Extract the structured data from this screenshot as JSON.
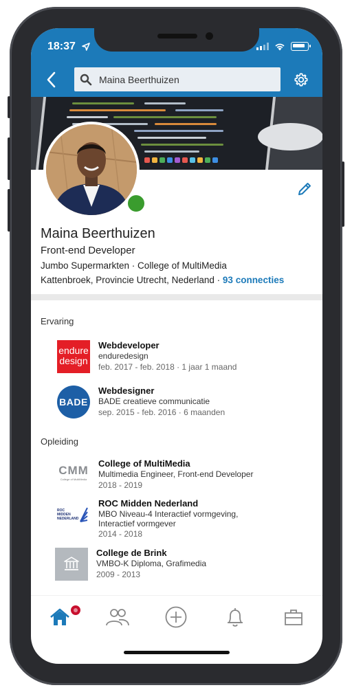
{
  "status_bar": {
    "time": "18:37"
  },
  "search": {
    "value": "Maina Beerthuizen"
  },
  "profile": {
    "name": "Maina Beerthuizen",
    "headline": "Front-end Developer",
    "companies": "Jumbo Supermarkten · College of MultiMedia",
    "location": "Kattenbroek, Provincie Utrecht, Nederland",
    "separator": "·",
    "connections": "93 connecties",
    "online_color": "#3a9c2e"
  },
  "experience": {
    "title": "Ervaring",
    "items": [
      {
        "role": "Webdeveloper",
        "company": "enduredesign",
        "period": "feb. 2017 - feb. 2018 · 1 jaar 1 maand",
        "logo_line1": "endure",
        "logo_line2": "design"
      },
      {
        "role": "Webdesigner",
        "company": "BADE creatieve communicatie",
        "period": "sep. 2015 - feb. 2016 · 6 maanden",
        "logo_text": "BADE"
      }
    ]
  },
  "education": {
    "title": "Opleiding",
    "items": [
      {
        "school": "College of MultiMedia",
        "degree": "Multimedia Engineer, Front-end Developer",
        "period": "2018 - 2019",
        "logo_text": "CMM",
        "logo_sub": "College of MultiMedia"
      },
      {
        "school": "ROC Midden Nederland",
        "degree": "MBO Niveau-4 Interactief vormgeving,",
        "degree2": "Interactief vormgever",
        "period": "2014 - 2018",
        "logo_text": "ROC MIDDEN NEDERLAND"
      },
      {
        "school": "College de Brink",
        "degree": "VMBO-K Diploma, Grafimedia",
        "period": "2009 - 2013"
      }
    ]
  },
  "tabs": [
    "home-tab",
    "network-tab",
    "post-tab",
    "notifications-tab",
    "jobs-tab"
  ],
  "colors": {
    "brand": "#1c7ab9",
    "notification": "#c8102e",
    "endure_red": "#e41e26",
    "bade_blue": "#1d5fa6"
  }
}
